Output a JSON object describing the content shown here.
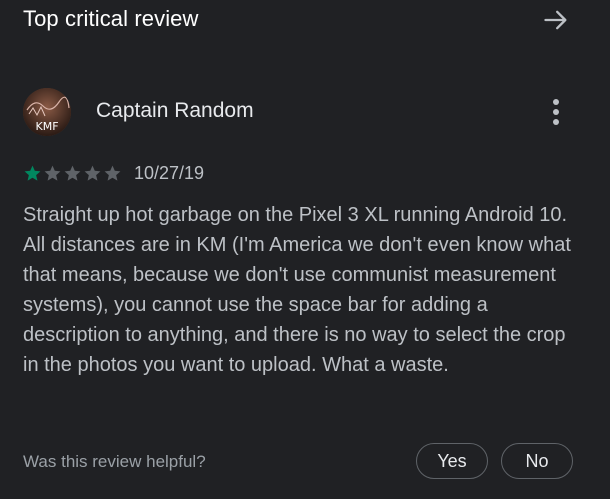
{
  "header": {
    "title": "Top critical review",
    "arrow_icon": "arrow-right-icon"
  },
  "review": {
    "avatar_text": "KMF",
    "reviewer_name": "Captain Random",
    "more_icon": "more-vert-icon",
    "rating": 1,
    "rating_max": 5,
    "date": "10/27/19",
    "body": "Straight up hot garbage on the Pixel 3 XL running Android 10. All distances are in KM (I'm America we don't even know what that means, because we don't use communist measurement systems), you cannot use the space bar for adding a description to anything, and there is no way to select the crop in the photos you want to upload. What a waste."
  },
  "helpful": {
    "question": "Was this review helpful?",
    "yes_label": "Yes",
    "no_label": "No"
  },
  "colors": {
    "background": "#202124",
    "star_filled": "#01875f",
    "star_empty": "#5f6368",
    "text_primary": "#e8eaed",
    "text_secondary": "#bdc1c6"
  }
}
